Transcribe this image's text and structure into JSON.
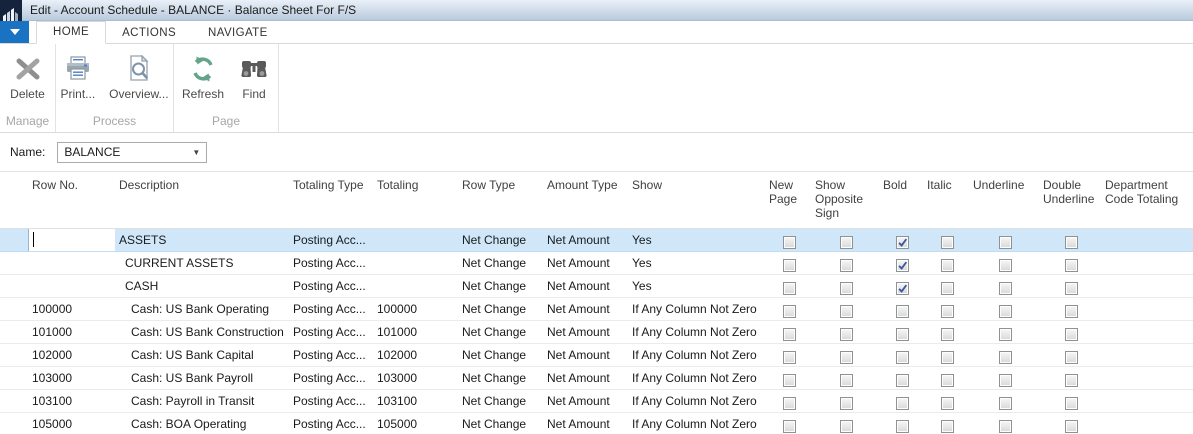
{
  "window": {
    "title": "Edit - Account Schedule - BALANCE · Balance Sheet For F/S"
  },
  "tabs": [
    {
      "label": "HOME",
      "active": true
    },
    {
      "label": "ACTIONS",
      "active": false
    },
    {
      "label": "NAVIGATE",
      "active": false
    }
  ],
  "ribbon": {
    "groups": [
      {
        "label": "Manage",
        "buttons": [
          {
            "label": "Delete",
            "icon": "delete-x-icon"
          }
        ]
      },
      {
        "label": "Process",
        "buttons": [
          {
            "label": "Print...",
            "icon": "printer-icon"
          },
          {
            "label": "Overview...",
            "icon": "overview-magnifier-icon"
          }
        ]
      },
      {
        "label": "Page",
        "buttons": [
          {
            "label": "Refresh",
            "icon": "refresh-icon"
          },
          {
            "label": "Find",
            "icon": "binoculars-icon"
          }
        ]
      }
    ]
  },
  "filter": {
    "name_label": "Name:",
    "name_value": "BALANCE"
  },
  "grid": {
    "columns": [
      "Row No.",
      "Description",
      "Totaling Type",
      "Totaling",
      "Row Type",
      "Amount Type",
      "Show",
      "New Page",
      "Show Opposite Sign",
      "Bold",
      "Italic",
      "Underline",
      "Double Underline",
      "Department Code Totaling"
    ],
    "rows": [
      {
        "selected": true,
        "row_no": "",
        "description": "ASSETS",
        "indent": 0,
        "totaling_type": "Posting Acc...",
        "totaling": "",
        "row_type": "Net Change",
        "amount_type": "Net Amount",
        "show": "Yes",
        "new_page": false,
        "show_opposite_sign": false,
        "bold": true,
        "italic": false,
        "underline": false,
        "double_underline": false,
        "department_code_totaling": ""
      },
      {
        "selected": false,
        "row_no": "",
        "description": "CURRENT ASSETS",
        "indent": 1,
        "totaling_type": "Posting Acc...",
        "totaling": "",
        "row_type": "Net Change",
        "amount_type": "Net Amount",
        "show": "Yes",
        "new_page": false,
        "show_opposite_sign": false,
        "bold": true,
        "italic": false,
        "underline": false,
        "double_underline": false,
        "department_code_totaling": ""
      },
      {
        "selected": false,
        "row_no": "",
        "description": "CASH",
        "indent": 1,
        "totaling_type": "Posting Acc...",
        "totaling": "",
        "row_type": "Net Change",
        "amount_type": "Net Amount",
        "show": "Yes",
        "new_page": false,
        "show_opposite_sign": false,
        "bold": true,
        "italic": false,
        "underline": false,
        "double_underline": false,
        "department_code_totaling": ""
      },
      {
        "selected": false,
        "row_no": "100000",
        "description": "Cash: US Bank Operating",
        "indent": 2,
        "totaling_type": "Posting Acc...",
        "totaling": "100000",
        "row_type": "Net Change",
        "amount_type": "Net Amount",
        "show": "If Any Column Not Zero",
        "new_page": false,
        "show_opposite_sign": false,
        "bold": false,
        "italic": false,
        "underline": false,
        "double_underline": false,
        "department_code_totaling": ""
      },
      {
        "selected": false,
        "row_no": "101000",
        "description": "Cash: US Bank Construction",
        "indent": 2,
        "totaling_type": "Posting Acc...",
        "totaling": "101000",
        "row_type": "Net Change",
        "amount_type": "Net Amount",
        "show": "If Any Column Not Zero",
        "new_page": false,
        "show_opposite_sign": false,
        "bold": false,
        "italic": false,
        "underline": false,
        "double_underline": false,
        "department_code_totaling": ""
      },
      {
        "selected": false,
        "row_no": "102000",
        "description": "Cash: US Bank Capital",
        "indent": 2,
        "totaling_type": "Posting Acc...",
        "totaling": "102000",
        "row_type": "Net Change",
        "amount_type": "Net Amount",
        "show": "If Any Column Not Zero",
        "new_page": false,
        "show_opposite_sign": false,
        "bold": false,
        "italic": false,
        "underline": false,
        "double_underline": false,
        "department_code_totaling": ""
      },
      {
        "selected": false,
        "row_no": "103000",
        "description": "Cash: US Bank Payroll",
        "indent": 2,
        "totaling_type": "Posting Acc...",
        "totaling": "103000",
        "row_type": "Net Change",
        "amount_type": "Net Amount",
        "show": "If Any Column Not Zero",
        "new_page": false,
        "show_opposite_sign": false,
        "bold": false,
        "italic": false,
        "underline": false,
        "double_underline": false,
        "department_code_totaling": ""
      },
      {
        "selected": false,
        "row_no": "103100",
        "description": "Cash: Payroll in Transit",
        "indent": 2,
        "totaling_type": "Posting Acc...",
        "totaling": "103100",
        "row_type": "Net Change",
        "amount_type": "Net Amount",
        "show": "If Any Column Not Zero",
        "new_page": false,
        "show_opposite_sign": false,
        "bold": false,
        "italic": false,
        "underline": false,
        "double_underline": false,
        "department_code_totaling": ""
      },
      {
        "selected": false,
        "row_no": "105000",
        "description": "Cash: BOA Operating",
        "indent": 2,
        "totaling_type": "Posting Acc...",
        "totaling": "105000",
        "row_type": "Net Change",
        "amount_type": "Net Amount",
        "show": "If Any Column Not Zero",
        "new_page": false,
        "show_opposite_sign": false,
        "bold": false,
        "italic": false,
        "underline": false,
        "double_underline": false,
        "department_code_totaling": ""
      }
    ]
  },
  "colors": {
    "accent_blue": "#1973c2",
    "selection_blue": "#cfe7f9",
    "check_blue": "#3a57a0",
    "refresh_green": "#64a487",
    "titlebar_gradient_top": "#e9f0f8",
    "titlebar_gradient_bottom": "#b9cadd"
  }
}
